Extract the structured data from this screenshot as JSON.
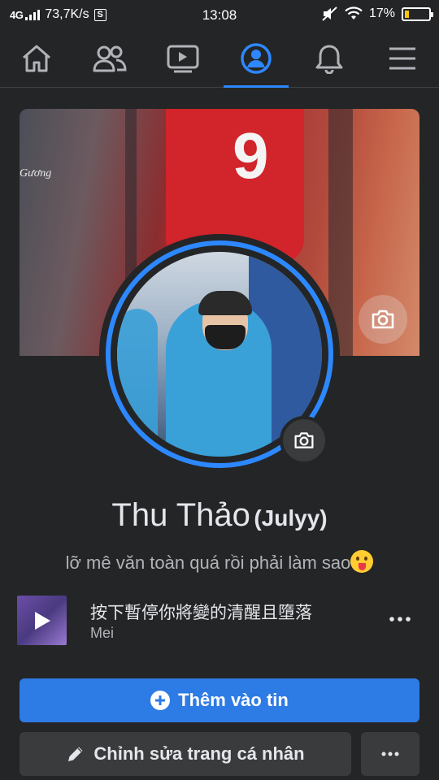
{
  "status_bar": {
    "network": "4G",
    "speed": "73,7K/s",
    "s_badge": "S",
    "time": "13:08",
    "battery_percent_text": "17%",
    "battery_level": 0.17
  },
  "nav": {
    "tabs": [
      {
        "name": "home",
        "icon": "home-icon",
        "active": false
      },
      {
        "name": "friends",
        "icon": "friends-icon",
        "active": false
      },
      {
        "name": "watch",
        "icon": "video-icon",
        "active": false
      },
      {
        "name": "profile",
        "icon": "profile-icon",
        "active": true
      },
      {
        "name": "notifications",
        "icon": "bell-icon",
        "active": false
      },
      {
        "name": "menu",
        "icon": "hamburger-menu-icon",
        "active": false
      }
    ],
    "accent": "#2d88ff"
  },
  "profile": {
    "cover_text": "Gương",
    "jersey_number": "9",
    "name": "Thu Thảo",
    "alt_name": "(Julyy)",
    "bio": "lỡ mê văn toàn quá rồi phải làm sao"
  },
  "music": {
    "title": "按下暫停你將變的清醒且墮落",
    "artist": "Mei"
  },
  "actions": {
    "add_story_label": "Thêm vào tin",
    "edit_profile_label": "Chỉnh sửa trang cá nhân"
  },
  "colors": {
    "background": "#242526",
    "primary_button": "#2d7be5",
    "secondary_button": "#3a3b3c"
  }
}
